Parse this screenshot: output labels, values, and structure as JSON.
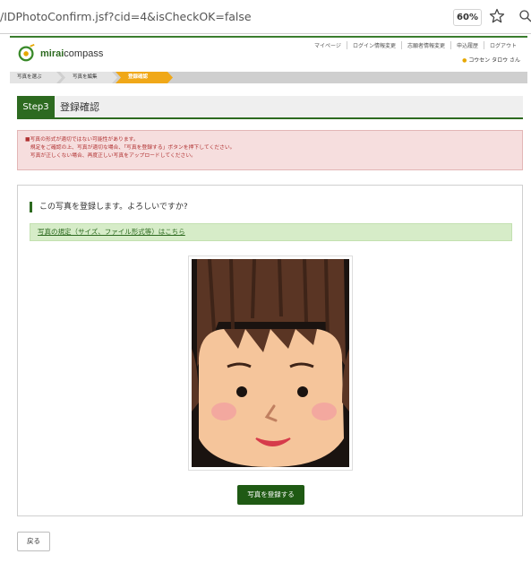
{
  "browser": {
    "url": "/IDPhotoConfirm.jsf?cid=4&isCheckOK=false",
    "zoom": "60%"
  },
  "header": {
    "logo_bold": "mirai",
    "logo_rest": "compass",
    "links": [
      "マイページ",
      "ログイン情報変更",
      "志願者情報変更",
      "申込履歴",
      "ログアウト"
    ],
    "user": "コウセン タロウ さん"
  },
  "breadcrumb": [
    "写真を選ぶ",
    "写真を編集",
    "登録確認"
  ],
  "step": {
    "tag": "Step3",
    "title": "登録確認"
  },
  "alert": {
    "lines": [
      "■写真の形式が適切ではない可能性があります。",
      "　規定をご確認の上、写真が適切な場合、「写真を登録する」ボタンを押下してください。",
      "　写真が正しくない場合、再度正しい写真をアップロードしてください。"
    ]
  },
  "main": {
    "question": "この写真を登録します。よろしいですか?",
    "info_link": "写真の規定（サイズ、ファイル形式等）はこちら",
    "register_button": "写真を登録する"
  },
  "footer": {
    "back_button": "戻る"
  },
  "colors": {
    "brand_green": "#2d6a20",
    "accent_orange": "#f0a818",
    "alert_bg": "#f6dede",
    "alert_text": "#b03030",
    "info_bg": "#d6ecc8"
  }
}
